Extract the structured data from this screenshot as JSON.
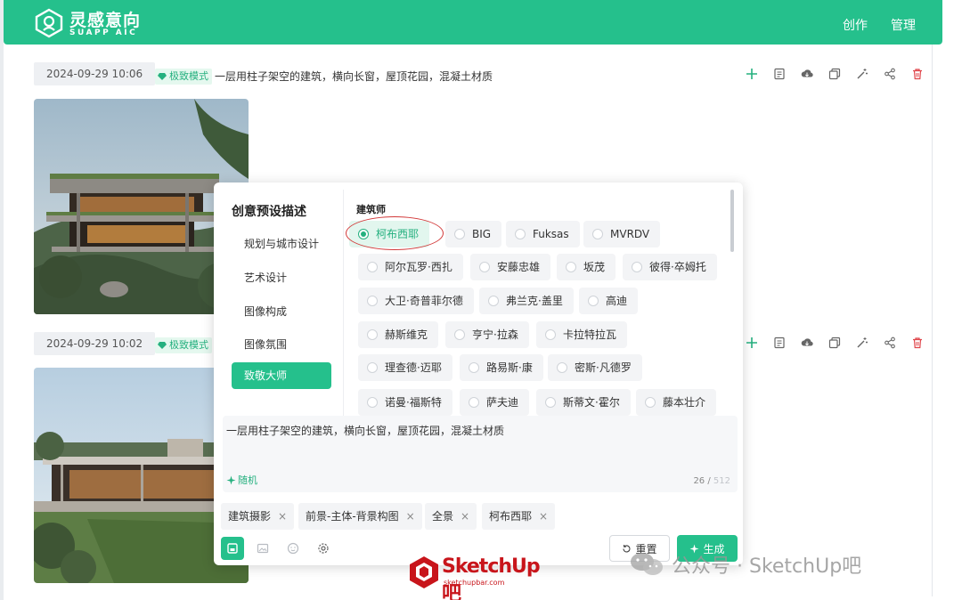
{
  "header": {
    "brand_cn": "灵感意向",
    "brand_en": "SUAPP AIC",
    "nav": [
      "创作",
      "管理"
    ]
  },
  "records": [
    {
      "date": "2024-09-29 10:06",
      "mode": "极致模式",
      "prompt": "一层用柱子架空的建筑，横向长窗，屋顶花园，混凝土材质"
    },
    {
      "date": "2024-09-29 10:02",
      "mode": "极致模式",
      "prompt": ""
    }
  ],
  "action_icons": [
    "plus-icon",
    "detail-icon",
    "download-icon",
    "copy-icon",
    "magic-wand-icon",
    "share-icon",
    "delete-icon"
  ],
  "popup": {
    "title": "创意预设描述",
    "categories": [
      "规划与城市设计",
      "艺术设计",
      "图像构成",
      "图像氛围",
      "致敬大师"
    ],
    "active_category": "致敬大师",
    "section_label": "建筑师",
    "architects": [
      [
        "柯布西耶",
        "BIG",
        "Fuksas",
        "MVRDV"
      ],
      [
        "阿尔瓦罗·西扎",
        "安藤忠雄",
        "坂茂",
        "彼得·卒姆托"
      ],
      [
        "大卫·奇普菲尔德",
        "弗兰克·盖里",
        "高迪"
      ],
      [
        "赫斯维克",
        "亨宁·拉森",
        "卡拉特拉瓦"
      ],
      [
        "理查德·迈耶",
        "路易斯·康",
        "密斯·凡德罗"
      ],
      [
        "诺曼·福斯特",
        "萨夫迪",
        "斯蒂文·霍尔",
        "藤本壮介"
      ]
    ],
    "selected_architect": "柯布西耶",
    "prompt_text": "一层用柱子架空的建筑，横向长窗，屋顶花园，混凝土材质",
    "random_label": "随机",
    "count_used": "26",
    "count_max": "512",
    "tags": [
      "建筑摄影",
      "前景-主体-背景构图",
      "全景",
      "柯布西耶"
    ],
    "tool_icons": [
      "image-mode-icon",
      "image-upload-icon",
      "face-icon",
      "settings-icon"
    ],
    "reset_label": "重置",
    "generate_label": "生成"
  },
  "watermark": {
    "wechat": "公众号 · SketchUp吧",
    "brand": "SketchUp吧",
    "brand_sub": "sketchupbar.com"
  },
  "colors": {
    "accent": "#25c08c",
    "accent_text": "#25b07f",
    "danger": "#e0464b"
  }
}
